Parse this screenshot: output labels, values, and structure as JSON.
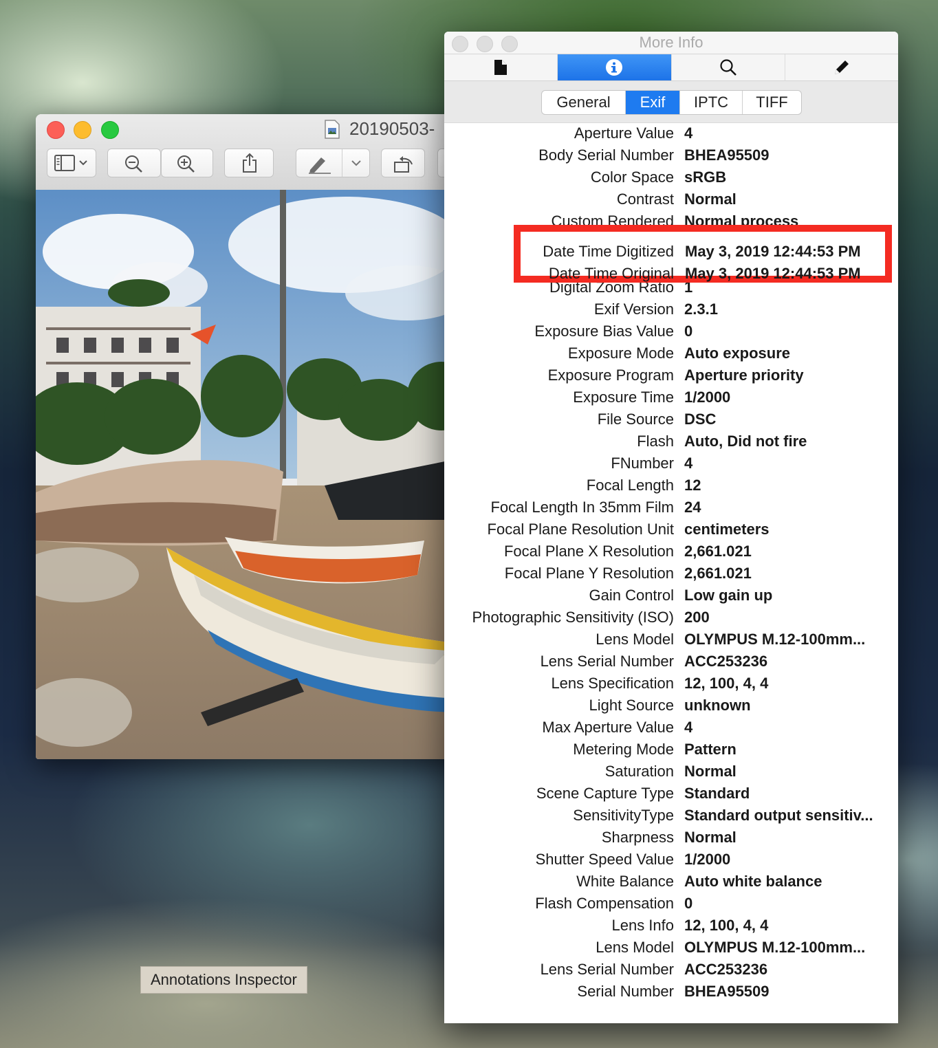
{
  "preview": {
    "title": "20190503-",
    "photo_subject": "Fishing boats on a beach"
  },
  "inspector": {
    "title": "More Info",
    "icon_tabs": [
      {
        "name": "document-icon",
        "active": false
      },
      {
        "name": "info-icon",
        "active": true
      },
      {
        "name": "search-icon",
        "active": false
      },
      {
        "name": "pencil-icon",
        "active": false
      }
    ],
    "segments": [
      "General",
      "Exif",
      "IPTC",
      "TIFF"
    ],
    "active_segment": "Exif",
    "rows": [
      {
        "key": "Aperture Value",
        "value": "4"
      },
      {
        "key": "Body Serial Number",
        "value": "BHEA95509"
      },
      {
        "key": "Color Space",
        "value": "sRGB"
      },
      {
        "key": "Contrast",
        "value": "Normal"
      },
      {
        "key": "Custom Rendered",
        "value": "Normal process"
      },
      {
        "key": "Date Time Digitized",
        "value": "May 3, 2019 12:44:53 PM"
      },
      {
        "key": "Date Time Original",
        "value": "May 3, 2019 12:44:53 PM"
      },
      {
        "key": "Digital Zoom Ratio",
        "value": "1"
      },
      {
        "key": "Exif Version",
        "value": "2.3.1"
      },
      {
        "key": "Exposure Bias Value",
        "value": "0"
      },
      {
        "key": "Exposure Mode",
        "value": "Auto exposure"
      },
      {
        "key": "Exposure Program",
        "value": "Aperture priority"
      },
      {
        "key": "Exposure Time",
        "value": "1/2000"
      },
      {
        "key": "File Source",
        "value": "DSC"
      },
      {
        "key": "Flash",
        "value": "Auto, Did not fire"
      },
      {
        "key": "FNumber",
        "value": "4"
      },
      {
        "key": "Focal Length",
        "value": "12"
      },
      {
        "key": "Focal Length In 35mm Film",
        "value": "24"
      },
      {
        "key": "Focal Plane Resolution Unit",
        "value": "centimeters"
      },
      {
        "key": "Focal Plane X Resolution",
        "value": "2,661.021"
      },
      {
        "key": "Focal Plane Y Resolution",
        "value": "2,661.021"
      },
      {
        "key": "Gain Control",
        "value": "Low gain up"
      },
      {
        "key": "Photographic Sensitivity (ISO)",
        "value": "200"
      },
      {
        "key": "Lens Model",
        "value": "OLYMPUS M.12-100mm..."
      },
      {
        "key": "Lens Serial Number",
        "value": "ACC253236"
      },
      {
        "key": "Lens Specification",
        "value": "12, 100, 4, 4"
      },
      {
        "key": "Light Source",
        "value": "unknown"
      },
      {
        "key": "Max Aperture Value",
        "value": "4"
      },
      {
        "key": "Metering Mode",
        "value": "Pattern"
      },
      {
        "key": "Saturation",
        "value": "Normal"
      },
      {
        "key": "Scene Capture Type",
        "value": "Standard"
      },
      {
        "key": "SensitivityType",
        "value": "Standard output sensitiv..."
      },
      {
        "key": "Sharpness",
        "value": "Normal"
      },
      {
        "key": "Shutter Speed Value",
        "value": "1/2000"
      },
      {
        "key": "White Balance",
        "value": "Auto white balance"
      },
      {
        "key": "Flash Compensation",
        "value": "0"
      },
      {
        "key": "Lens Info",
        "value": "12, 100, 4, 4"
      },
      {
        "key": "Lens Model",
        "value": "OLYMPUS M.12-100mm..."
      },
      {
        "key": "Lens Serial Number",
        "value": "ACC253236"
      },
      {
        "key": "Serial Number",
        "value": "BHEA95509"
      }
    ],
    "highlighted_rows": [
      5,
      6
    ],
    "highlight_color": "#f42b22"
  },
  "tooltip": {
    "text": "Annotations Inspector"
  }
}
